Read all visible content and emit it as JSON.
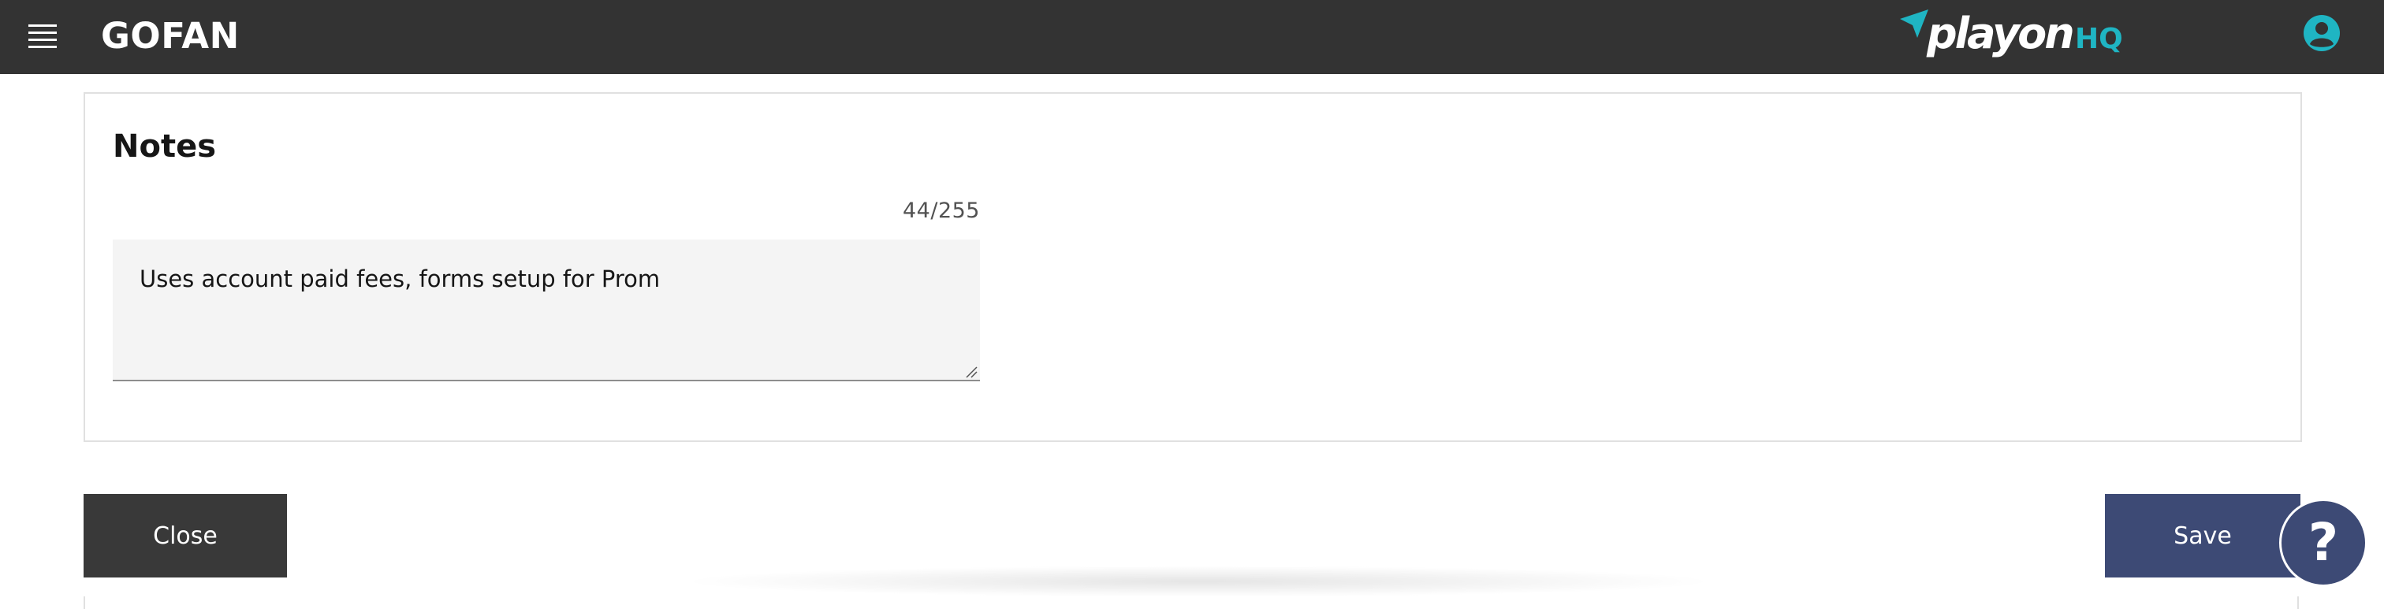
{
  "header": {
    "app_title": "GOFAN",
    "brand": {
      "word": "playon",
      "suffix": "HQ",
      "suffix_color": "#1fb5c3"
    },
    "menu_icon": "hamburger-menu-icon",
    "user_icon": "user-avatar-icon",
    "background_color": "#333333"
  },
  "notes": {
    "heading": "Notes",
    "char_count": "44/255",
    "value": "Uses account paid fees, forms setup for Prom"
  },
  "actions": {
    "close_label": "Close",
    "save_label": "Save",
    "help_label": "?",
    "save_color": "#3d4a75",
    "close_color": "#393939"
  }
}
